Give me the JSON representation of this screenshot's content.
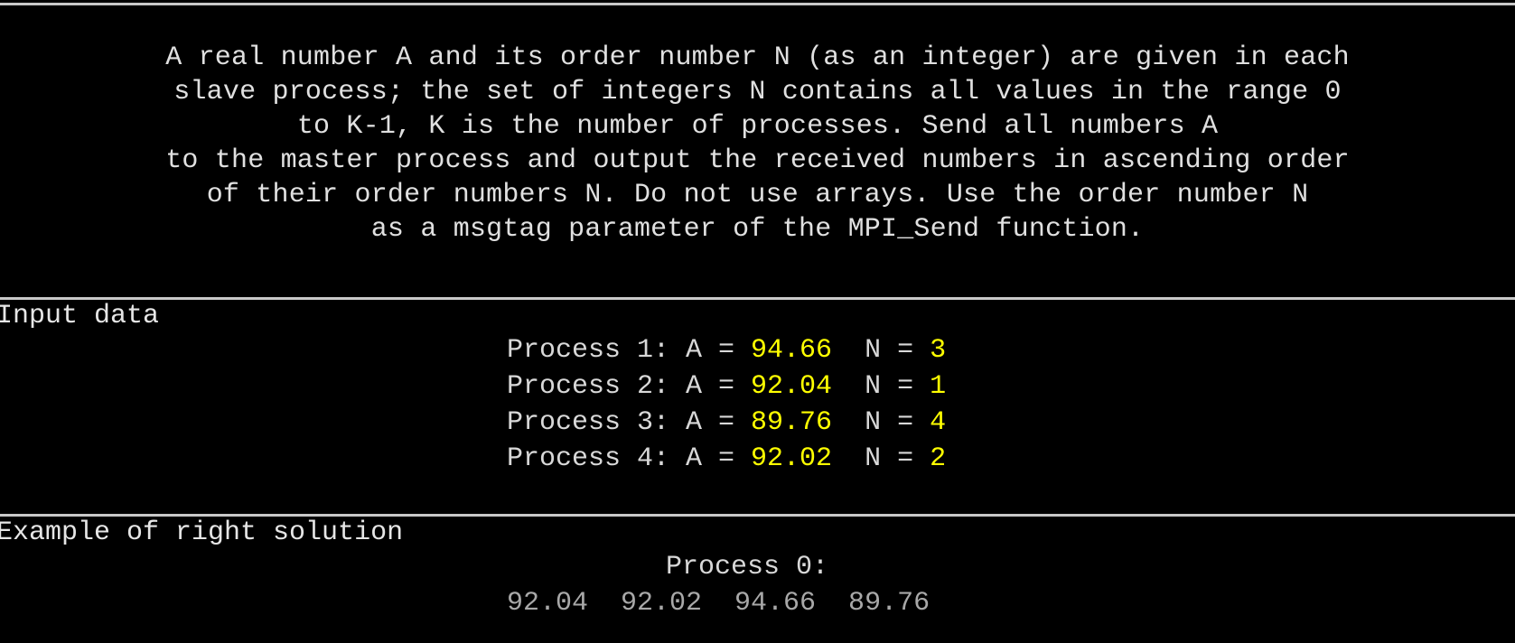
{
  "task": {
    "lines": [
      "A real number A and its order number N (as an integer) are given in each",
      "slave process; the set of integers N contains all values in the range 0",
      "to K-1, K is the number of processes. Send all numbers A",
      "to the master process and output the received numbers in ascending order",
      "of their order numbers N. Do not use arrays. Use the order number N",
      "as a msgtag parameter of the MPI_Send function."
    ]
  },
  "input_section": {
    "label": "Input data",
    "rows": [
      {
        "prefix": "Process 1: A = ",
        "a": "94.66",
        "mid": "  N = ",
        "n": "3"
      },
      {
        "prefix": "Process 2: A = ",
        "a": "92.04",
        "mid": "  N = ",
        "n": "1"
      },
      {
        "prefix": "Process 3: A = ",
        "a": "89.76",
        "mid": "  N = ",
        "n": "4"
      },
      {
        "prefix": "Process 4: A = ",
        "a": "92.02",
        "mid": "  N = ",
        "n": "2"
      }
    ]
  },
  "solution_section": {
    "label": "Example of right solution",
    "process_header": "Process 0:",
    "values": "92.04  92.02  94.66  89.76"
  },
  "colors": {
    "background": "#000000",
    "text": "#d8d8d8",
    "highlight": "#ffff00",
    "muted": "#a8a8a8",
    "separator": "#c8c8c8"
  }
}
